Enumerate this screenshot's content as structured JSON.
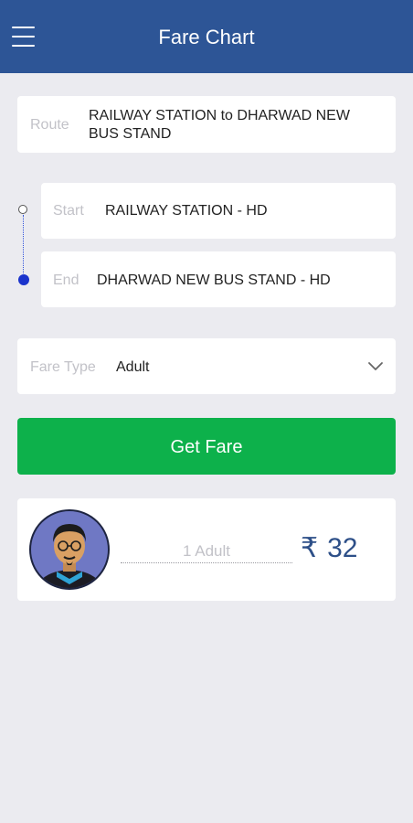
{
  "header": {
    "title": "Fare Chart",
    "menu_icon": "hamburger-menu-icon"
  },
  "route": {
    "label": "Route",
    "value_line1": "RAILWAY STATION to DHARWAD NEW",
    "value_line2": "BUS STAND"
  },
  "start": {
    "label": "Start",
    "value": "RAILWAY STATION - HD"
  },
  "end": {
    "label": "End",
    "value": "DHARWAD NEW BUS STAND - HD"
  },
  "fare_type": {
    "label": "Fare Type",
    "value": "Adult",
    "icon": "chevron-down-icon"
  },
  "get_fare_button": {
    "label": "Get Fare"
  },
  "result": {
    "passengers": "1 Adult",
    "currency_symbol": "₹",
    "amount": "32",
    "avatar_icon": "person-avatar-icon"
  },
  "colors": {
    "appbar": "#2d5596",
    "button": "#0db14b",
    "amount_text": "#2d4f88",
    "background": "#ebebf0"
  }
}
